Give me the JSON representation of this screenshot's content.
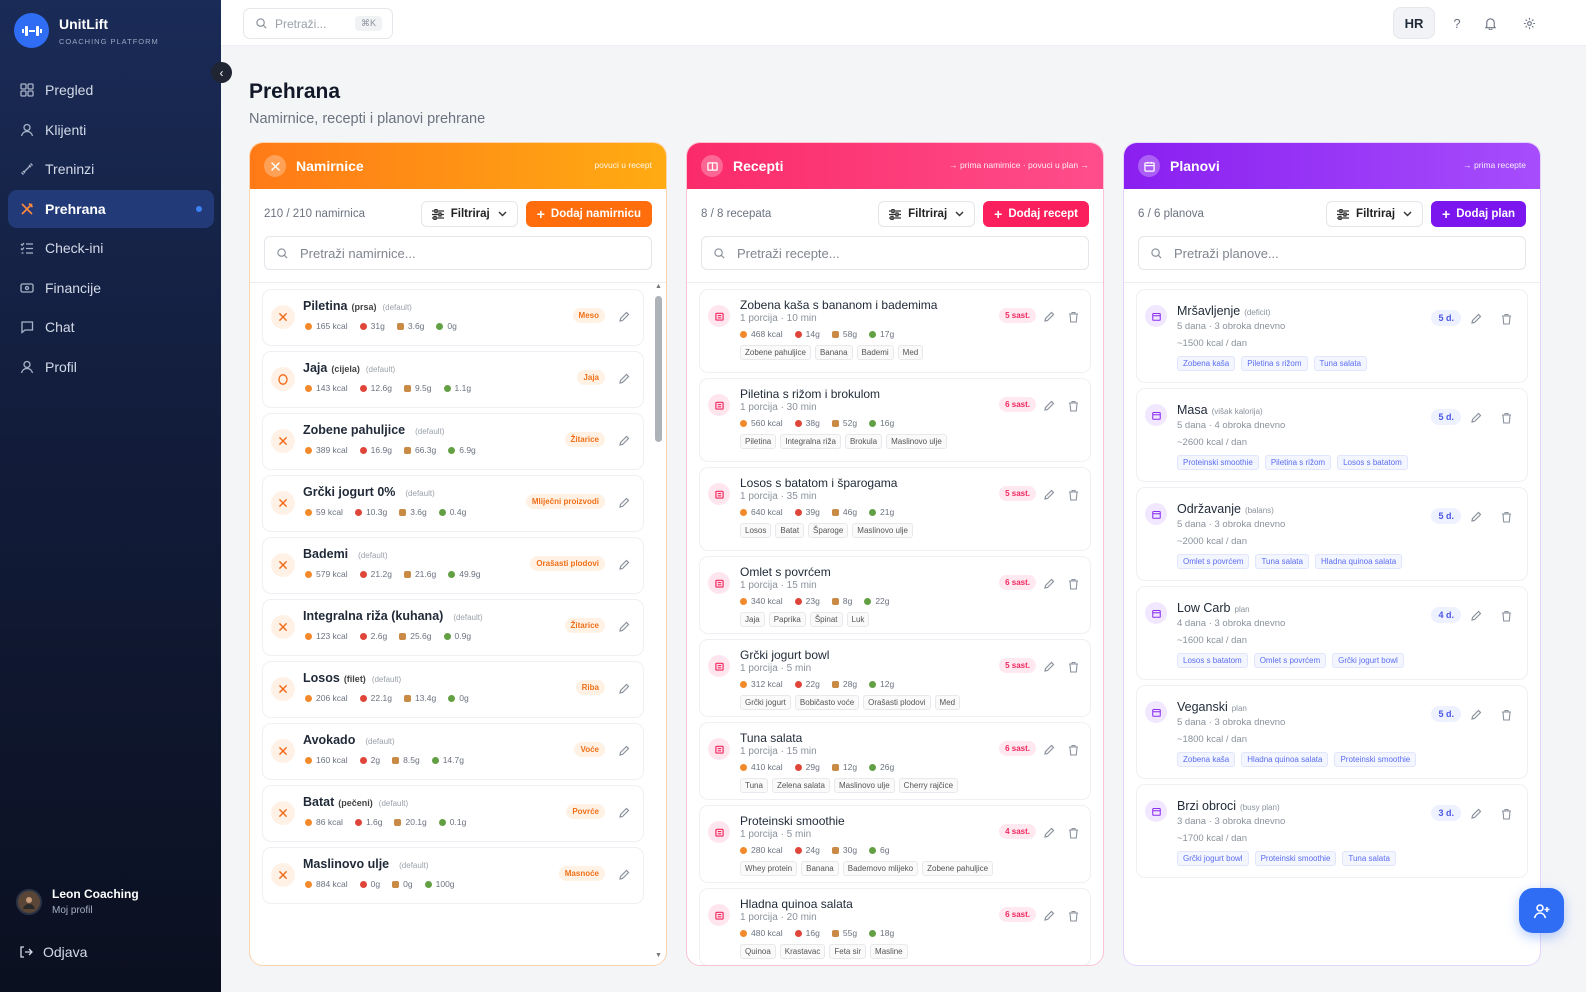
{
  "app": {
    "name": "UnitLift",
    "tagline": "COACHING PLATFORM"
  },
  "nav": [
    {
      "label": "Pregled",
      "icon": "grid-icon",
      "active": false
    },
    {
      "label": "Klijenti",
      "icon": "user-icon",
      "active": false
    },
    {
      "label": "Treninzi",
      "icon": "dumbbell-icon",
      "active": false
    },
    {
      "label": "Prehrana",
      "icon": "utensils-icon",
      "active": true
    },
    {
      "label": "Check-ini",
      "icon": "checklist-icon",
      "active": false
    },
    {
      "label": "Financije",
      "icon": "wallet-icon",
      "active": false
    },
    {
      "label": "Chat",
      "icon": "chat-icon",
      "active": false
    },
    {
      "label": "Profil",
      "icon": "user-icon",
      "active": false
    }
  ],
  "profile": {
    "name": "Leon Coaching",
    "sub": "Moj profil"
  },
  "logout": "Odjava",
  "topbar": {
    "search_placeholder": "Pretraži...",
    "shortcut": "⌘K",
    "lang": "HR"
  },
  "page": {
    "title": "Prehrana",
    "subtitle": "Namirnice, recepti i planovi prehrane"
  },
  "foods": {
    "title": "Namirnice",
    "hint": "povuci u recept",
    "count": "210 / 210 namirnica",
    "filter": "Filtriraj",
    "add": "Dodaj namirnicu",
    "search": "Pretraži namirnice...",
    "items": [
      {
        "name": "Piletina",
        "qual": "(prsa)",
        "def": "(default)",
        "kcal": "165 kcal",
        "p": "31g",
        "c": "3.6g",
        "f": "0g",
        "cat": "Meso"
      },
      {
        "name": "Jaja",
        "qual": "(cijela)",
        "def": "(default)",
        "kcal": "143 kcal",
        "p": "12.6g",
        "c": "9.5g",
        "f": "1.1g",
        "cat": "Jaja"
      },
      {
        "name": "Zobene pahuljice",
        "qual": "",
        "def": "(default)",
        "kcal": "389 kcal",
        "p": "16.9g",
        "c": "66.3g",
        "f": "6.9g",
        "cat": "Žitarice"
      },
      {
        "name": "Grčki jogurt 0%",
        "qual": "",
        "def": "(default)",
        "kcal": "59 kcal",
        "p": "10.3g",
        "c": "3.6g",
        "f": "0.4g",
        "cat": "Mliječni proizvodi"
      },
      {
        "name": "Bademi",
        "qual": "",
        "def": "(default)",
        "kcal": "579 kcal",
        "p": "21.2g",
        "c": "21.6g",
        "f": "49.9g",
        "cat": "Orašasti plodovi"
      },
      {
        "name": "Integralna riža (kuhana)",
        "qual": "",
        "def": "(default)",
        "kcal": "123 kcal",
        "p": "2.6g",
        "c": "25.6g",
        "f": "0.9g",
        "cat": "Žitarice"
      },
      {
        "name": "Losos",
        "qual": "(filet)",
        "def": "(default)",
        "kcal": "206 kcal",
        "p": "22.1g",
        "c": "13.4g",
        "f": "0g",
        "cat": "Riba"
      },
      {
        "name": "Avokado",
        "qual": "",
        "def": "(default)",
        "kcal": "160 kcal",
        "p": "2g",
        "c": "8.5g",
        "f": "14.7g",
        "cat": "Voće"
      },
      {
        "name": "Batat",
        "qual": "(pečeni)",
        "def": "(default)",
        "kcal": "86 kcal",
        "p": "1.6g",
        "c": "20.1g",
        "f": "0.1g",
        "cat": "Povrće"
      },
      {
        "name": "Maslinovo ulje",
        "qual": "",
        "def": "(default)",
        "kcal": "884 kcal",
        "p": "0g",
        "c": "0g",
        "f": "100g",
        "cat": "Masnoće"
      }
    ]
  },
  "recipes": {
    "title": "Recepti",
    "hint": "→ prima namirnice · povuci u plan →",
    "count": "8 / 8 recepata",
    "filter": "Filtriraj",
    "add": "Dodaj recept",
    "search": "Pretraži recepte...",
    "items": [
      {
        "name": "Zobena kaša s bananom i bademima",
        "meta": "1 porcija · 10 min",
        "kcal": "468 kcal",
        "p": "14g",
        "c": "58g",
        "f": "17g",
        "count": "5 sast.",
        "tags": [
          "Zobene pahuljice",
          "Banana",
          "Bademi",
          "Med"
        ]
      },
      {
        "name": "Piletina s rižom i brokulom",
        "meta": "1 porcija · 30 min",
        "kcal": "560 kcal",
        "p": "38g",
        "c": "52g",
        "f": "16g",
        "count": "6 sast.",
        "tags": [
          "Piletina",
          "Integralna riža",
          "Brokula",
          "Maslinovo ulje"
        ]
      },
      {
        "name": "Losos s batatom i šparogama",
        "meta": "1 porcija · 35 min",
        "kcal": "640 kcal",
        "p": "39g",
        "c": "46g",
        "f": "21g",
        "count": "5 sast.",
        "tags": [
          "Losos",
          "Batat",
          "Šparoge",
          "Maslinovo ulje"
        ]
      },
      {
        "name": "Omlet s povrćem",
        "meta": "1 porcija · 15 min",
        "kcal": "340 kcal",
        "p": "23g",
        "c": "8g",
        "f": "22g",
        "count": "6 sast.",
        "tags": [
          "Jaja",
          "Paprika",
          "Špinat",
          "Luk"
        ]
      },
      {
        "name": "Grčki jogurt bowl",
        "meta": "1 porcija · 5 min",
        "kcal": "312 kcal",
        "p": "22g",
        "c": "28g",
        "f": "12g",
        "count": "5 sast.",
        "tags": [
          "Grčki jogurt",
          "Bobičasto voće",
          "Orašasti plodovi",
          "Med"
        ]
      },
      {
        "name": "Tuna salata",
        "meta": "1 porcija · 15 min",
        "kcal": "410 kcal",
        "p": "29g",
        "c": "12g",
        "f": "26g",
        "count": "6 sast.",
        "tags": [
          "Tuna",
          "Zelena salata",
          "Maslinovo ulje",
          "Cherry rajčice"
        ]
      },
      {
        "name": "Proteinski smoothie",
        "meta": "1 porcija · 5 min",
        "kcal": "280 kcal",
        "p": "24g",
        "c": "30g",
        "f": "6g",
        "count": "4 sast.",
        "tags": [
          "Whey protein",
          "Banana",
          "Bademovo mlijeko",
          "Zobene pahuljice"
        ]
      },
      {
        "name": "Hladna quinoa salata",
        "meta": "1 porcija · 20 min",
        "kcal": "480 kcal",
        "p": "16g",
        "c": "55g",
        "f": "18g",
        "count": "6 sast.",
        "tags": [
          "Quinoa",
          "Krastavac",
          "Feta sir",
          "Masline"
        ]
      }
    ]
  },
  "plans": {
    "title": "Planovi",
    "hint": "→ prima recepte",
    "count": "6 / 6 planova",
    "filter": "Filtriraj",
    "add": "Dodaj plan",
    "search": "Pretraži planove...",
    "items": [
      {
        "name": "Mršavljenje",
        "note": "(deficit)",
        "meta": "5 dana · 3 obroka dnevno",
        "kcal": "~1500 kcal / dan",
        "days": "5 d.",
        "tags": [
          "Zobena kaša",
          "Piletina s rižom",
          "Tuna salata"
        ]
      },
      {
        "name": "Masa",
        "note": "(višak kalorija)",
        "meta": "5 dana · 4 obroka dnevno",
        "kcal": "~2600 kcal / dan",
        "days": "5 d.",
        "tags": [
          "Proteinski smoothie",
          "Piletina s rižom",
          "Losos s batatom"
        ]
      },
      {
        "name": "Održavanje",
        "note": "(balans)",
        "meta": "5 dana · 3 obroka dnevno",
        "kcal": "~2000 kcal / dan",
        "days": "5 d.",
        "tags": [
          "Omlet s povrćem",
          "Tuna salata",
          "Hladna quinoa salata"
        ]
      },
      {
        "name": "Low Carb",
        "note": "plan",
        "meta": "4 dana · 3 obroka dnevno",
        "kcal": "~1600 kcal / dan",
        "days": "4 d.",
        "tags": [
          "Losos s batatom",
          "Omlet s povrćem",
          "Grčki jogurt bowl"
        ]
      },
      {
        "name": "Veganski",
        "note": "plan",
        "meta": "5 dana · 3 obroka dnevno",
        "kcal": "~1800 kcal / dan",
        "days": "5 d.",
        "tags": [
          "Zobena kaša",
          "Hladna quinoa salata",
          "Proteinski smoothie"
        ]
      },
      {
        "name": "Brzi obroci",
        "note": "(busy plan)",
        "meta": "3 dana · 3 obroka dnevno",
        "kcal": "~1700 kcal / dan",
        "days": "3 d.",
        "tags": [
          "Grčki jogurt bowl",
          "Proteinski smoothie",
          "Tuna salata"
        ]
      }
    ]
  },
  "colors": {
    "accent": "#2f6df5",
    "food": "#ff7a17",
    "recipe": "#fb2b6a",
    "plan": "#8a1ff0",
    "sidebar": "#121c3a"
  }
}
